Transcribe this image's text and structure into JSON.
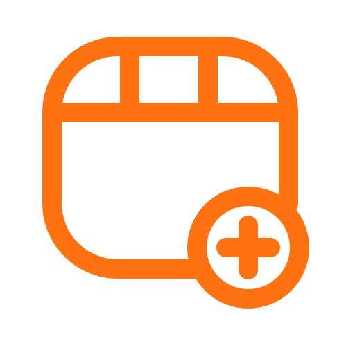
{
  "icon": {
    "name": "video-grid-add-icon",
    "stroke_color": "#FF7212",
    "background_color": "#FFFFFF"
  }
}
